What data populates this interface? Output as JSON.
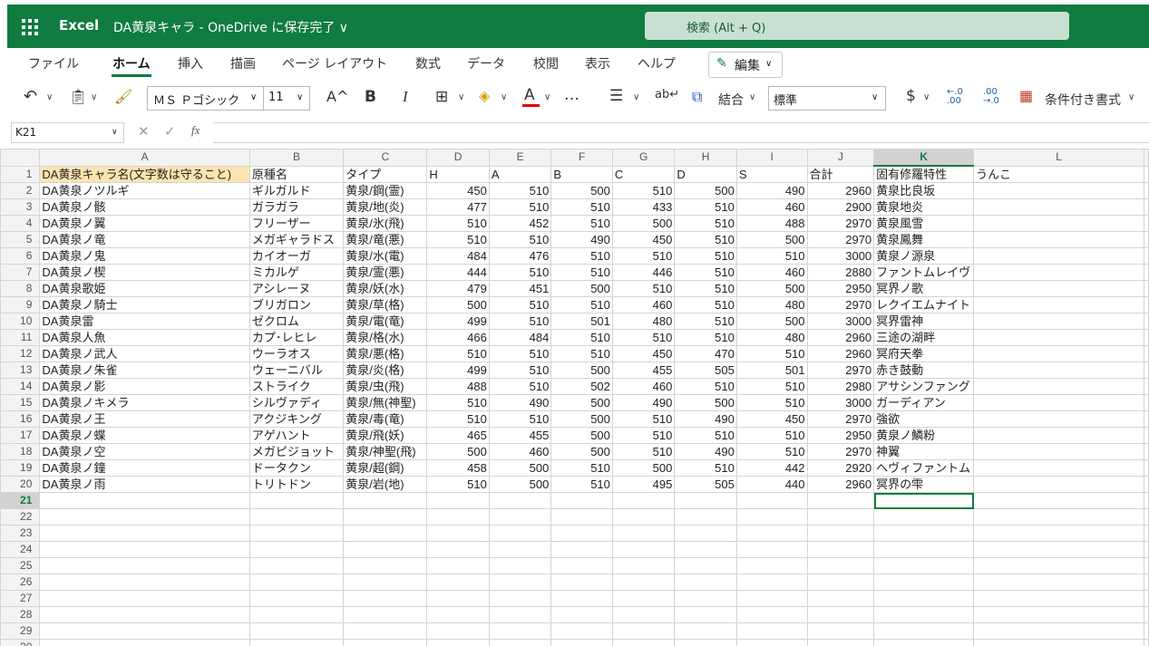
{
  "app": {
    "name": "Excel",
    "doc_title": "DA黄泉キャラ - OneDrive に保存完了 ∨",
    "search_placeholder": "検索 (Alt + Q)"
  },
  "menu": {
    "tabs": [
      "ファイル",
      "ホーム",
      "挿入",
      "描画",
      "ページ レイアウト",
      "数式",
      "データ",
      "校閲",
      "表示",
      "ヘルプ"
    ],
    "active": "ホーム",
    "edit_label": "編集"
  },
  "ribbon": {
    "font_name": "ＭＳ Ｐゴシック",
    "font_size": "11",
    "merge_label": "結合",
    "number_format": "標準",
    "conditional_label": "条件付き書式",
    "bold": "B",
    "italic": "I",
    "font_color_letter": "A",
    "grow_font": "A^",
    "currency": "$",
    "more": "…",
    "font_color": "#e00000"
  },
  "formula_bar": {
    "name_box": "K21",
    "fx": "fx",
    "value": ""
  },
  "grid": {
    "columns": [
      "A",
      "B",
      "C",
      "D",
      "E",
      "F",
      "G",
      "H",
      "I",
      "J",
      "K",
      "L"
    ],
    "selected_column": "K",
    "selected_row": "21",
    "selected_cell": "K21",
    "highlight_color": "#fce4b0",
    "accent": "#107c41",
    "header_row": [
      "DA黄泉キャラ名(文字数は守ること)",
      "原種名",
      "タイプ",
      "H",
      "A",
      "B",
      "C",
      "D",
      "S",
      "合計",
      "固有修羅特性",
      "うんこ"
    ],
    "rows": [
      [
        "DA黄泉ノツルギ",
        "ギルガルド",
        "黄泉/鋼(霊)",
        "450",
        "510",
        "500",
        "510",
        "500",
        "490",
        "2960",
        "黄泉比良坂",
        ""
      ],
      [
        "DA黄泉ノ骸",
        "ガラガラ",
        "黄泉/地(炎)",
        "477",
        "510",
        "510",
        "433",
        "510",
        "460",
        "2900",
        "黄泉地炎",
        ""
      ],
      [
        "DA黄泉ノ翼",
        "フリーザー",
        "黄泉/氷(飛)",
        "510",
        "452",
        "510",
        "500",
        "510",
        "488",
        "2970",
        "黄泉風雪",
        ""
      ],
      [
        "DA黄泉ノ竜",
        "メガギャラドス",
        "黄泉/竜(悪)",
        "510",
        "510",
        "490",
        "450",
        "510",
        "500",
        "2970",
        "黄泉鳳舞",
        ""
      ],
      [
        "DA黄泉ノ鬼",
        "カイオーガ",
        "黄泉/水(電)",
        "484",
        "476",
        "510",
        "510",
        "510",
        "510",
        "3000",
        "黄泉ノ源泉",
        ""
      ],
      [
        "DA黄泉ノ楔",
        "ミカルゲ",
        "黄泉/霊(悪)",
        "444",
        "510",
        "510",
        "446",
        "510",
        "460",
        "2880",
        "ファントムレイヴ",
        ""
      ],
      [
        "DA黄泉歌姫",
        "アシレーヌ",
        "黄泉/妖(水)",
        "479",
        "451",
        "500",
        "510",
        "510",
        "500",
        "2950",
        "冥界ノ歌",
        ""
      ],
      [
        "DA黄泉ノ騎士",
        "ブリガロン",
        "黄泉/草(格)",
        "500",
        "510",
        "510",
        "460",
        "510",
        "480",
        "2970",
        "レクイエムナイト",
        ""
      ],
      [
        "DA黄泉雷",
        "ゼクロム",
        "黄泉/電(竜)",
        "499",
        "510",
        "501",
        "480",
        "510",
        "500",
        "3000",
        "冥界雷神",
        ""
      ],
      [
        "DA黄泉人魚",
        "カプ･レヒレ",
        "黄泉/格(水)",
        "466",
        "484",
        "510",
        "510",
        "510",
        "480",
        "2960",
        "三途の湖畔",
        ""
      ],
      [
        "DA黄泉ノ武人",
        "ウーラオス",
        "黄泉/悪(格)",
        "510",
        "510",
        "510",
        "450",
        "470",
        "510",
        "2960",
        "冥府天拳",
        ""
      ],
      [
        "DA黄泉ノ朱雀",
        "ウェーニバル",
        "黄泉/炎(格)",
        "499",
        "510",
        "500",
        "455",
        "505",
        "501",
        "2970",
        "赤き鼓動",
        ""
      ],
      [
        "DA黄泉ノ影",
        "ストライク",
        "黄泉/虫(飛)",
        "488",
        "510",
        "502",
        "460",
        "510",
        "510",
        "2980",
        "アサシンファング",
        ""
      ],
      [
        "DA黄泉ノキメラ",
        "シルヴァディ",
        "黄泉/無(神聖)",
        "510",
        "490",
        "500",
        "490",
        "500",
        "510",
        "3000",
        "ガーディアン",
        ""
      ],
      [
        "DA黄泉ノ王",
        "アクジキング",
        "黄泉/毒(竜)",
        "510",
        "510",
        "500",
        "510",
        "490",
        "450",
        "2970",
        "強欲",
        ""
      ],
      [
        "DA黄泉ノ蝶",
        "アゲハント",
        "黄泉/飛(妖)",
        "465",
        "455",
        "500",
        "510",
        "510",
        "510",
        "2950",
        "黄泉ノ鱗粉",
        ""
      ],
      [
        "DA黄泉ノ空",
        "メガピジョット",
        "黄泉/神聖(飛)",
        "500",
        "460",
        "500",
        "510",
        "490",
        "510",
        "2970",
        "神翼",
        ""
      ],
      [
        "DA黄泉ノ鐘",
        "ドータクン",
        "黄泉/超(鋼)",
        "458",
        "500",
        "510",
        "500",
        "510",
        "442",
        "2920",
        "ヘヴィファントム",
        ""
      ],
      [
        "DA黄泉ノ雨",
        "トリトドン",
        "黄泉/岩(地)",
        "510",
        "500",
        "510",
        "495",
        "505",
        "440",
        "2960",
        "冥界の雫",
        ""
      ]
    ],
    "empty_row_numbers": [
      "21",
      "22",
      "23",
      "24",
      "25",
      "26",
      "27",
      "28",
      "29",
      "30"
    ]
  }
}
